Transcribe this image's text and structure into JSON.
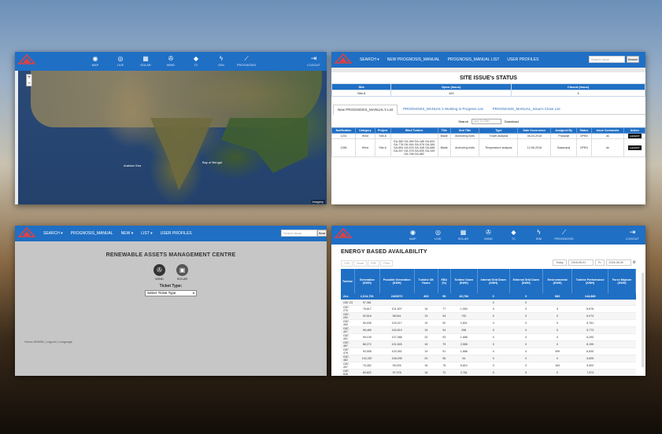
{
  "toolbar_icons": [
    {
      "label": "MAP",
      "icon": "globe-icon"
    },
    {
      "label": "LIVE",
      "icon": "target-icon"
    },
    {
      "label": "SOLAR",
      "icon": "grid-icon"
    },
    {
      "label": "WIND",
      "icon": "wind-turbine-icon"
    },
    {
      "label": "TC",
      "icon": "tag-icon"
    },
    {
      "label": "IDM",
      "icon": "bolt-icon"
    },
    {
      "label": "PROGNOSIS",
      "icon": "chart-icon"
    }
  ],
  "toolbar_icons_p4": [
    {
      "label": "MAP",
      "icon": "globe-icon"
    },
    {
      "label": "LIVE",
      "icon": "target-icon"
    },
    {
      "label": "SOLAR",
      "icon": "grid-icon"
    },
    {
      "label": "WIND",
      "icon": "wind-turbine-icon"
    },
    {
      "label": "TC",
      "icon": "tag-icon"
    },
    {
      "label": "IDM",
      "icon": "bolt-icon"
    },
    {
      "label": "PROGNOSIS",
      "icon": "chart-icon"
    }
  ],
  "logout_label": "LOGOUT",
  "map": {
    "labels": [
      "Bay of Bengal",
      "Arabian Sea"
    ],
    "credit": "Imagery"
  },
  "nav_p2": {
    "items": [
      "SEARCH ▾",
      "NEW PROGNOSIS_MANUAL",
      "PROGNOSIS_MANUAL LIST",
      "USER PROFILES"
    ],
    "search_placeholder": "Search issue",
    "search_button": "Search"
  },
  "site_issue": {
    "title": "SITE ISSUE's STATUS",
    "headers": [
      "Site",
      "Open (Issue)",
      "Closed (Issue)"
    ],
    "row": [
      "Site-6",
      "103",
      "3"
    ],
    "tabs": [
      "New PROGNOSIS_MANUAL's List",
      "PROGNOSIS_MANUAL's Working in Progress List",
      "PROGNOSIS_MANUAL_Issue's Close List"
    ],
    "filter_label": "Search",
    "filter_placeholder": "Type To Filter",
    "download": "Download",
    "issue_headers": [
      "Notification",
      "Category",
      "Project",
      "Wind Turbine",
      "Title",
      "Sub Title",
      "Type",
      "Date Occurrence",
      "Assigned By",
      "Status",
      "Issue Comments",
      "Action"
    ],
    "issue_rows": [
      [
        "1231",
        "Wind",
        "Site-6",
        "",
        "Blade",
        "Anchoring bolts",
        "Travel analysis",
        "06-03-2018",
        "Prasanjit",
        "OPEN",
        "as",
        "Add/EDIT"
      ],
      [
        "1286",
        "Wind",
        "Site-6",
        "GA-360 GA-369 GA-186 GA-691 GA-778 GA-944 GA-976 GA-384 GA-654 GA-676 GA-348 GA-686 GA-347 GA-378 GA-690 GA-349 GA-768 GA-882",
        "Blade",
        "Anchoring bolts",
        "Temperature analysis",
        "12-06-2018",
        "Basavaraj",
        "OPEN",
        "de",
        "Add/EDIT"
      ]
    ]
  },
  "nav_p3": {
    "items": [
      "SEARCH ▾",
      "PROGNOSIS_MANUAL",
      "NEW ▾",
      "LIST ▾",
      "USER PROFILES"
    ],
    "search_placeholder": "Search issue",
    "search_button": "Sear"
  },
  "p3": {
    "heading": "RENEWABLE ASSETS MANAGEMENT CENTRE",
    "wind_label": "WIND",
    "solar_label": "SOLAR",
    "ticket_label": "Ticket Type:",
    "ticket_value": "Select Ticket Type",
    "footer": "Home ADMIN | Logout | Language"
  },
  "energy": {
    "title": "ENERGY BASED AVAILABILITY",
    "export_buttons": [
      "CSV",
      "Excel",
      "PDF",
      "Print"
    ],
    "today": "Today",
    "from_date": "2018-06-01",
    "to_label": "To",
    "to_date": "2018-06-30",
    "headers": [
      "Turbine",
      "Generation (KWH)",
      "Possible Generation (KWH)",
      "Turbine OK Hours",
      "EBA (%)",
      "Turbine Down (KWH)",
      "Internal Grid Down (KWH)",
      "External Grid Down (KWH)",
      "Environmental (KWH)",
      "Turbine Performance (KWH)",
      "Force Majeure (KWH)"
    ],
    "total": [
      "ALL",
      "2,314,751",
      "2423072",
      "463",
      "98",
      "40,784",
      "0",
      "0",
      "682",
      "144,880",
      ""
    ],
    "rows": [
      [
        "G87-23",
        "97,381",
        "",
        "",
        "",
        "",
        "0",
        "0",
        "",
        "",
        ""
      ],
      [
        "G87-276",
        "78,617",
        "101,507",
        "16",
        "77",
        "1,953",
        "0",
        "0",
        "5",
        "8,676",
        ""
      ],
      [
        "G87-292",
        "92,516",
        "98,541",
        "19",
        "94",
        "732",
        "0",
        "0",
        "0",
        "6,074",
        ""
      ],
      [
        "G87-390",
        "95,935",
        "103,217",
        "19",
        "92",
        "2,821",
        "0",
        "0",
        "0",
        "5,761",
        ""
      ],
      [
        "G87-407",
        "98,469",
        "104,519",
        "19",
        "94",
        "298",
        "0",
        "0",
        "0",
        "5,773",
        ""
      ],
      [
        "G87-451",
        "99,109",
        "107,088",
        "20",
        "93",
        "1,686",
        "0",
        "0",
        "0",
        "6,290",
        ""
      ],
      [
        "G87-467",
        "86,272",
        "101,545",
        "16",
        "79",
        "2,558",
        "0",
        "0",
        "0",
        "8,195",
        ""
      ],
      [
        "G87-476",
        "93,555",
        "102,061",
        "19",
        "91",
        "1,686",
        "0",
        "0",
        "499",
        "6,830",
        ""
      ],
      [
        "G87-482",
        "102,357",
        "108,295",
        "20",
        "95",
        "94",
        "0",
        "0",
        "0",
        "5,605",
        ""
      ],
      [
        "G87-497",
        "75,452",
        "99,025",
        "16",
        "76",
        "5,810",
        "0",
        "0",
        "164",
        "5,502",
        ""
      ],
      [
        "G87-516",
        "69,822",
        "97,078",
        "16",
        "72",
        "2,761",
        "0",
        "0",
        "0",
        "7,573",
        ""
      ]
    ]
  }
}
